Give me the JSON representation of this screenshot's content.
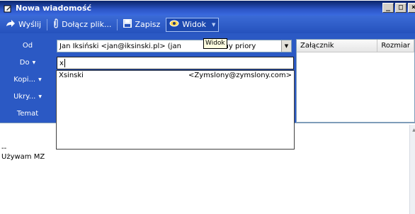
{
  "window": {
    "title": "Nowa wiadomość",
    "controls": [
      "_",
      "□",
      "×"
    ]
  },
  "toolbar": {
    "send_label": "Wyślij",
    "attach_label": "Dołącz plik...",
    "save_label": "Zapisz",
    "view_label": "Widok"
  },
  "tooltip": "Widok",
  "fields": {
    "from_label": "Od",
    "from_value": "Jan Iksiński <jan@iksinski.pl>   (jan",
    "priority_value": "rmalny priory",
    "to_label": "Do",
    "to_value": "x",
    "cc_label": "Kopi...",
    "bcc_label": "Ukry...",
    "subject_label": "Temat"
  },
  "autocomplete": {
    "items": [
      {
        "name": "Xsinski",
        "email": "<Zymslony@zymslony.com>"
      }
    ]
  },
  "attachments": {
    "columns": [
      "Załącznik",
      "Rozmiar"
    ]
  },
  "body": {
    "lines": [
      "--",
      "Używam MZ"
    ]
  }
}
